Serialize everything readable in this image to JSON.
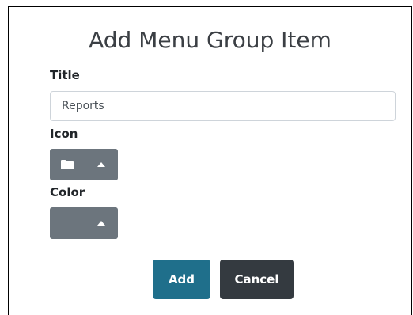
{
  "dialog": {
    "title": "Add Menu Group Item"
  },
  "form": {
    "title_label": "Title",
    "title_value": "Reports",
    "icon_label": "Icon",
    "icon_selected": "folder-icon",
    "color_label": "Color"
  },
  "actions": {
    "add_label": "Add",
    "cancel_label": "Cancel"
  },
  "colors": {
    "picker_button": "#6c757d",
    "add_button": "#1f6f8b",
    "cancel_button": "#343a40"
  }
}
